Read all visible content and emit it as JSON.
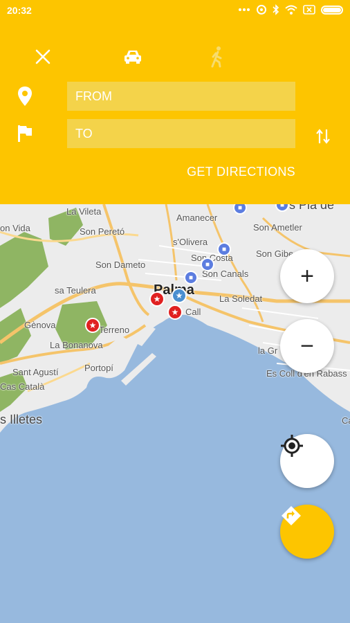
{
  "status_bar": {
    "time": "20:32",
    "icons": [
      "more-dots-icon",
      "alarm-icon",
      "bluetooth-icon",
      "wifi-icon",
      "sim-off-icon",
      "battery-icon"
    ]
  },
  "directions_panel": {
    "background": "#fdc500",
    "modes": [
      {
        "name": "close",
        "icon": "close-icon"
      },
      {
        "name": "car",
        "icon": "car-icon",
        "selected": true
      },
      {
        "name": "walk",
        "icon": "walk-icon",
        "selected": false
      }
    ],
    "from": {
      "placeholder": "FROM",
      "value": "",
      "icon": "location-pin-icon"
    },
    "to": {
      "placeholder": "TO",
      "value": "",
      "icon": "flag-icon"
    },
    "swap_icon": "swap-vertical-icon",
    "get_directions_label": "GET DIRECTIONS"
  },
  "map": {
    "labels": {
      "la_vileta": "La Vileta",
      "son_vida": "on Vida",
      "son_pereto": "Son Peretó",
      "amanecer": "Amanecer",
      "pla_de": "s Pla de",
      "son_ametler": "Son Ametler",
      "solivera": "s'Olivera",
      "son_dameto": "Son Dameto",
      "son_costa": "Son Costa",
      "son_gibert": "Son Gibe",
      "son_canals": "Son Canals",
      "sa_teulera": "sa Teulera",
      "palma": "Palma",
      "la_soledat": "La Soledat",
      "call": "Call",
      "genova": "Gènova",
      "terreno": "Terreno",
      "la_bonanova": "La Bonanova",
      "la_gr": "la Gr",
      "portopi": "Portopí",
      "es_coll": "Es Coll d'en Rabass",
      "sant_agusti": "Sant Agustí",
      "cas_catala": "Cas Català",
      "illetes": "s Illetes",
      "ca": "Ca"
    },
    "zoom_in_label": "+",
    "zoom_out_label": "−",
    "locate_icon": "my-location-icon",
    "directions_icon": "directions-icon"
  }
}
